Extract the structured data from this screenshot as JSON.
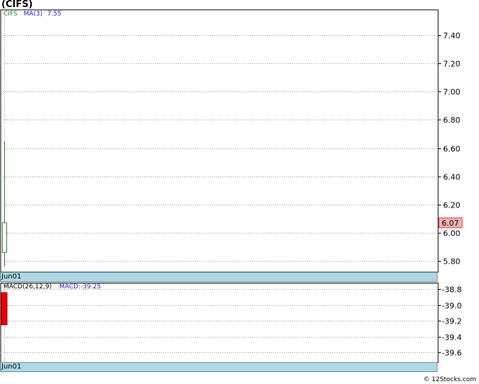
{
  "title": "(CIFS)",
  "colors": {
    "price_up": "#2e7d32",
    "ma_label": "#1f1fbf",
    "price_tag_bg": "#f4b2b2",
    "macd_bar": "#ee0000",
    "date_bar": "#add8e6"
  },
  "price_panel": {
    "legend_symbol": "CIFS",
    "legend_ma": "MA(3)",
    "legend_ma_value": "7.55",
    "current_price_tag": "6.07",
    "date_label": "Jun01"
  },
  "macd_panel": {
    "legend_name": "MACD(26,12,9)",
    "legend_value": "MACD:-39.25",
    "date_label": "Jun01"
  },
  "footer": "© 12Stocks.com",
  "chart_data": [
    {
      "type": "candlestick",
      "title": "(CIFS)",
      "series": [
        {
          "name": "CIFS",
          "x": [
            "Jun01"
          ],
          "open": [
            5.86
          ],
          "high": [
            6.65
          ],
          "low": [
            5.76
          ],
          "close": [
            6.07
          ]
        }
      ],
      "y_ticks": [
        5.8,
        6.0,
        6.2,
        6.4,
        6.6,
        6.8,
        7.0,
        7.2,
        7.4
      ],
      "y_tick_labels": [
        "5.80",
        "6.00",
        "6.20",
        "6.40",
        "6.60",
        "6.80",
        "7.00",
        "7.20",
        "7.40"
      ],
      "ylim": [
        5.72,
        7.58
      ],
      "ma": {
        "name": "MA(3)",
        "value": 7.55
      },
      "last_price": 6.07,
      "grid": true
    },
    {
      "type": "bar",
      "title": "MACD(26,12,9)",
      "series": [
        {
          "name": "MACD",
          "x": [
            "Jun01"
          ],
          "values": [
            -39.25
          ]
        }
      ],
      "y_ticks": [
        -38.8,
        -39.0,
        -39.2,
        -39.4,
        -39.6
      ],
      "y_tick_labels": [
        "-38.8",
        "-39.0",
        "-39.2",
        "-39.4",
        "-39.6"
      ],
      "ylim": [
        -39.72,
        -38.72
      ],
      "grid": true
    }
  ]
}
